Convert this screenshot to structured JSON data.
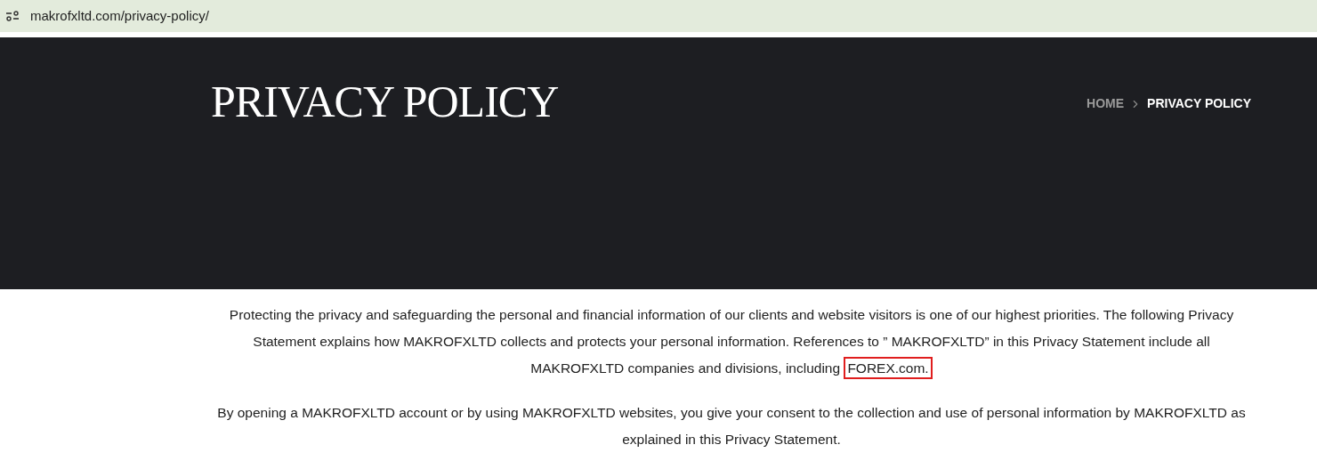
{
  "address_bar": {
    "url": "makrofxltd.com/privacy-policy/"
  },
  "header": {
    "title": "PRIVACY POLICY",
    "breadcrumb": [
      {
        "label": "HOME",
        "selected": false
      },
      {
        "label": "PRIVACY POLICY",
        "selected": true
      }
    ]
  },
  "paragraphs": [
    {
      "text": "Protecting the privacy and safeguarding the personal and financial information of our clients and website visitors is one of our highest priorities. The following Privacy Statement explains how MAKROFXLTD collects and protects your personal information. References to ” MAKROFXLTD” in this Privacy Statement include all MAKROFXLTD companies and divisions, including ",
      "highlight": "FOREX.com."
    },
    {
      "text": "By opening a MAKROFXLTD account or by using MAKROFXLTD websites, you give your consent to the collection and use of personal information by MAKROFXLTD as explained in this Privacy Statement."
    }
  ]
}
